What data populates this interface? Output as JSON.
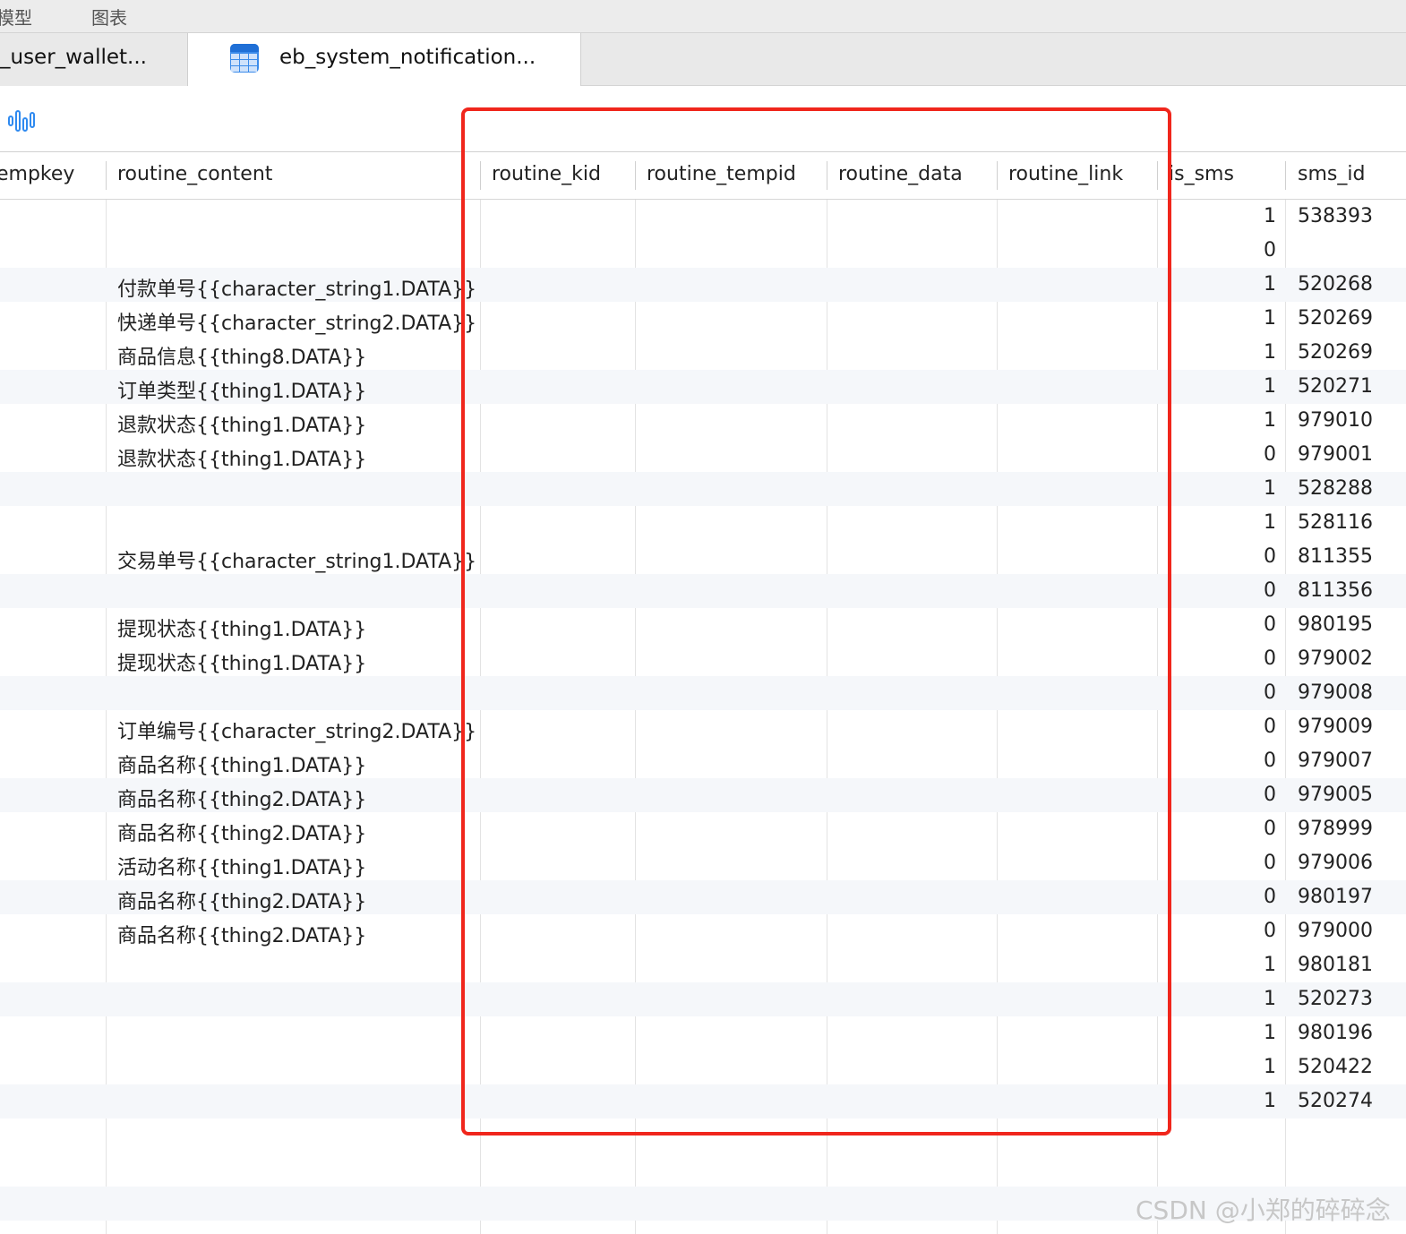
{
  "menu": {
    "model": "模型",
    "chart": "图表"
  },
  "tabs": [
    {
      "label": "_user_wallet..."
    },
    {
      "label": "eb_system_notification..."
    }
  ],
  "columns": {
    "tempkey": "empkey",
    "routine_content": "routine_content",
    "routine_kid": "routine_kid",
    "routine_tempid": "routine_tempid",
    "routine_data": "routine_data",
    "routine_link": "routine_link",
    "is_sms": "is_sms",
    "sms_id": "sms_id"
  },
  "rows": [
    {
      "routine_content": "",
      "is_sms": "1",
      "sms_id": "538393"
    },
    {
      "routine_content": "",
      "is_sms": "0",
      "sms_id": ""
    },
    {
      "routine_content": "付款单号{{character_string1.DATA}}",
      "is_sms": "1",
      "sms_id": "520268"
    },
    {
      "routine_content": "快递单号{{character_string2.DATA}}",
      "is_sms": "1",
      "sms_id": "520269"
    },
    {
      "routine_content": "商品信息{{thing8.DATA}}",
      "is_sms": "1",
      "sms_id": "520269"
    },
    {
      "routine_content": "订单类型{{thing1.DATA}}",
      "is_sms": "1",
      "sms_id": "520271"
    },
    {
      "routine_content": "退款状态{{thing1.DATA}}",
      "is_sms": "1",
      "sms_id": "979010"
    },
    {
      "routine_content": "退款状态{{thing1.DATA}}",
      "is_sms": "0",
      "sms_id": "979001"
    },
    {
      "routine_content": "",
      "is_sms": "1",
      "sms_id": "528288"
    },
    {
      "routine_content": "",
      "is_sms": "1",
      "sms_id": "528116"
    },
    {
      "routine_content": "交易单号{{character_string1.DATA}}",
      "is_sms": "0",
      "sms_id": "811355"
    },
    {
      "routine_content": "",
      "is_sms": "0",
      "sms_id": "811356"
    },
    {
      "routine_content": "提现状态{{thing1.DATA}}",
      "is_sms": "0",
      "sms_id": "980195"
    },
    {
      "routine_content": "提现状态{{thing1.DATA}}",
      "is_sms": "0",
      "sms_id": "979002"
    },
    {
      "routine_content": "",
      "is_sms": "0",
      "sms_id": "979008"
    },
    {
      "routine_content": "订单编号{{character_string2.DATA}}",
      "is_sms": "0",
      "sms_id": "979009"
    },
    {
      "routine_content": "商品名称{{thing1.DATA}}",
      "is_sms": "0",
      "sms_id": "979007"
    },
    {
      "routine_content": "商品名称{{thing2.DATA}}",
      "is_sms": "0",
      "sms_id": "979005"
    },
    {
      "routine_content": "商品名称{{thing2.DATA}}",
      "is_sms": "0",
      "sms_id": "978999"
    },
    {
      "routine_content": "活动名称{{thing1.DATA}}",
      "is_sms": "0",
      "sms_id": "979006"
    },
    {
      "routine_content": "商品名称{{thing2.DATA}}",
      "is_sms": "0",
      "sms_id": "980197"
    },
    {
      "routine_content": "商品名称{{thing2.DATA}}",
      "is_sms": "0",
      "sms_id": "979000"
    },
    {
      "routine_content": "",
      "is_sms": "1",
      "sms_id": "980181"
    },
    {
      "routine_content": "",
      "is_sms": "1",
      "sms_id": "520273"
    },
    {
      "routine_content": "",
      "is_sms": "1",
      "sms_id": "980196"
    },
    {
      "routine_content": "",
      "is_sms": "1",
      "sms_id": "520422"
    },
    {
      "routine_content": "",
      "is_sms": "1",
      "sms_id": "520274"
    }
  ],
  "watermark": "CSDN @小郑的碎碎念",
  "colors": {
    "highlight": "#f0261c",
    "accent": "#3b8bea"
  }
}
